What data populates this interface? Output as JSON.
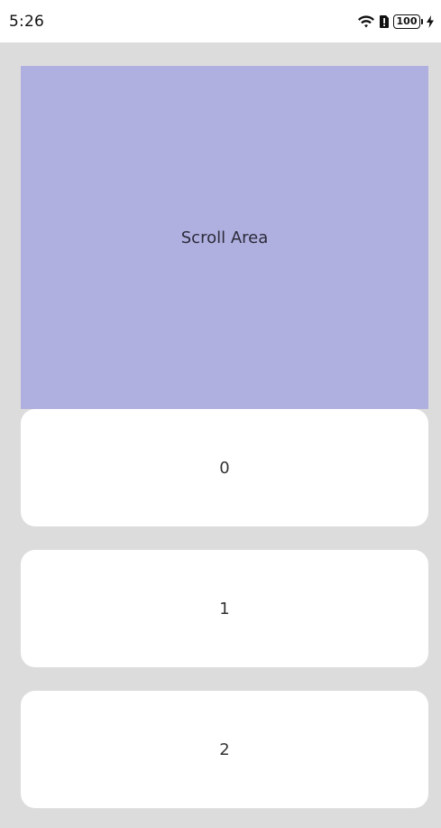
{
  "status_bar": {
    "time": "5:26",
    "battery_level": "100",
    "icons": [
      "wifi-icon",
      "sim-alert-icon",
      "battery-icon",
      "charging-icon"
    ]
  },
  "scroll_area": {
    "label": "Scroll Area",
    "color": "#b0b0e0"
  },
  "list": {
    "items": [
      {
        "label": "0"
      },
      {
        "label": "1"
      },
      {
        "label": "2"
      }
    ]
  }
}
